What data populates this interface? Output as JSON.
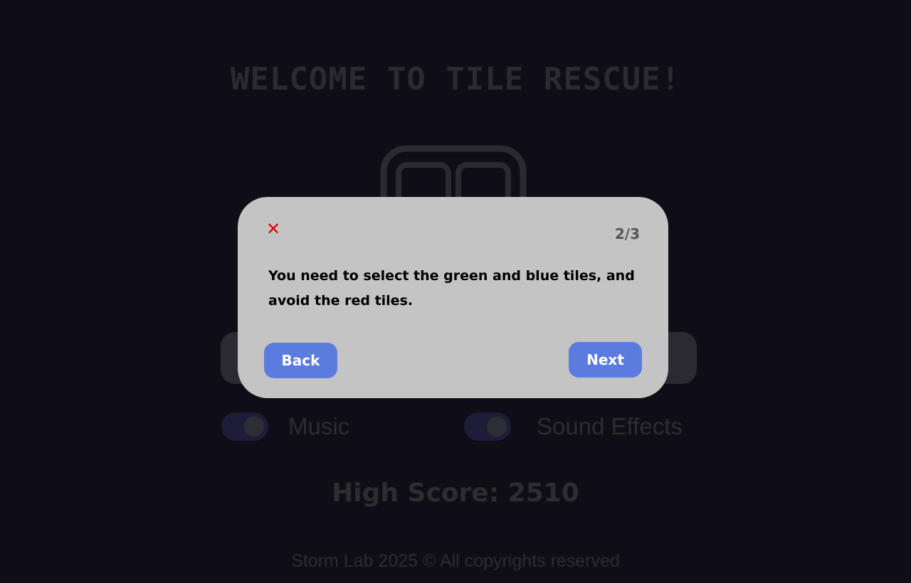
{
  "game": {
    "title": "WELCOME TO TILE RESCUE!",
    "settings": {
      "music_label": "Music",
      "music_on": true,
      "sfx_label": "Sound Effects",
      "sfx_on": true
    },
    "high_score_text": "High Score: 2510",
    "footer": "Storm Lab 2025 © All copyrights reserved"
  },
  "tutorial": {
    "close_symbol": "✕",
    "step": "2/3",
    "message": "You need to select the green and blue tiles, and avoid the red tiles.",
    "back_label": "Back",
    "next_label": "Next"
  },
  "colors": {
    "background": "#0f0e16",
    "modal": "#c4c4c4",
    "button": "#5b7bdf",
    "close": "#e00000"
  }
}
